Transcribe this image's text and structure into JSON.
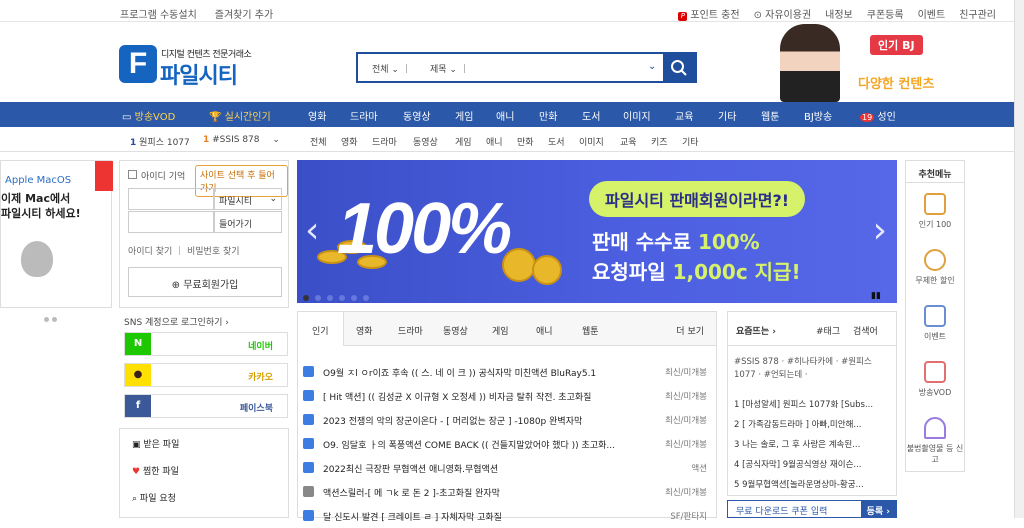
{
  "topbar": {
    "left": [
      "프로그램 수동설치",
      "즐겨찾기 추가"
    ],
    "right": [
      "포인트 충전",
      "자유이용권",
      "내정보",
      "쿠폰등록",
      "이벤트",
      "친구관리"
    ]
  },
  "logo": {
    "mark": "F",
    "sub": "디지털 컨텐츠 전문거래소",
    "main": "파일시티"
  },
  "search": {
    "category": "전체",
    "field": "제목"
  },
  "banner": {
    "badge": "인기 BJ",
    "sub": "다양한 컨텐츠"
  },
  "nav": [
    "방송VOD",
    "실시간인기",
    "영화",
    "드라마",
    "동영상",
    "게임",
    "애니",
    "만화",
    "도서",
    "이미지",
    "교육",
    "기타",
    "웹툰",
    "BJ방송",
    "성인"
  ],
  "adult_badge": "19",
  "subnav": {
    "ranks": [
      {
        "n": "1",
        "t": "원피스 1077"
      },
      {
        "n": "1",
        "t": "#SSIS 878"
      }
    ],
    "cats": [
      "전체",
      "영화",
      "드라마",
      "동영상",
      "게임",
      "애니",
      "만화",
      "도서",
      "이미지",
      "교육",
      "키즈",
      "기타"
    ]
  },
  "ad_left": {
    "t1": "Apple MacOS",
    "t2": "이제 Mac에서\n파일시티 하세요!"
  },
  "login": {
    "remember": "아이디 기억",
    "select_site": "사이트 선택 후 들어가기",
    "site": "파일시티",
    "enter": "들어가기",
    "find_id": "아이디 찾기",
    "find_pw": "비밀번호 찾기",
    "join": "무료회원가입"
  },
  "sns": {
    "title": "SNS 계정으로 로그인하기",
    "naver": "네이버",
    "kakao": "카카오",
    "facebook": "페이스북"
  },
  "mymenu": [
    "받은 파일",
    "찜한 파일",
    "파일 요청"
  ],
  "slide": {
    "big": "100%",
    "pill": "파일시티 판매회원이라면?!",
    "l2a": "판매 수수료 ",
    "l2b": "100%",
    "l3a": "요청파일 ",
    "l3b": "1,000c 지급!"
  },
  "tabs": {
    "items": [
      "인기",
      "영화",
      "드라마",
      "동영상",
      "게임",
      "애니",
      "웹툰"
    ],
    "more": "더 보기"
  },
  "list": [
    {
      "t": "O9월 ㅈl ㅇr이죠 후속 (( 스. 네 이 크 )) 공식자막 미친액션 BluRay5.1",
      "c": "최신/미개봉"
    },
    {
      "t": "[ Hit 액션] (( 김성균 X 이규형 X 오정세 )) 비자금 탈취 작전. 초고화질",
      "c": "최신/미개봉"
    },
    {
      "t": "2023 전쟁의 악의 장군이온다 - [ 머리없는 장군 ] -1080p 완벽자막",
      "c": "최신/미개봉"
    },
    {
      "t": "O9. 임달호 ㅏ의 폭풍액션 COME BACK (( 건들지말았어야 했다 )) 초고화...",
      "c": "최신/미개봉"
    },
    {
      "t": "2022최신 극장판 무협액션 애니영화.무협액션",
      "c": "액션"
    },
    {
      "t": "액션스릴러-[ 메 ㄱk 로 돈 2 ]-초고화질 완자막",
      "c": "최신/미개봉"
    },
    {
      "t": "달 신도시 발견 [ 크레이트 ㄹ ] 자체자막 고화질",
      "c": "SF/판타지"
    }
  ],
  "hot": {
    "title": "요즘뜨는",
    "tag": "#태그",
    "search": "검색어",
    "tags": "#SSIS 878 · #히나타카에 · #원피스 1077 · #언되는데 ·",
    "rows": [
      "1  [마성알세] 원피스 1077화 [Subs...",
      "2  [ 가족감동드라마 ] 아빠,미안해...",
      "3  나는 솔로, 그 후 사랑은 계속된...",
      "4  [공식자막] 9월공식영상 재이슨...",
      "5  9월무협액션[놀라운명상마-황궁..."
    ]
  },
  "coupon": {
    "text": "무료 다운로드 쿠폰 입력",
    "btn": "등록"
  },
  "rec": {
    "title": "추천메뉴",
    "items": [
      "인기 100",
      "무제한 할인",
      "이벤트",
      "방송VOD",
      "불법촬영물 등 신고"
    ]
  }
}
